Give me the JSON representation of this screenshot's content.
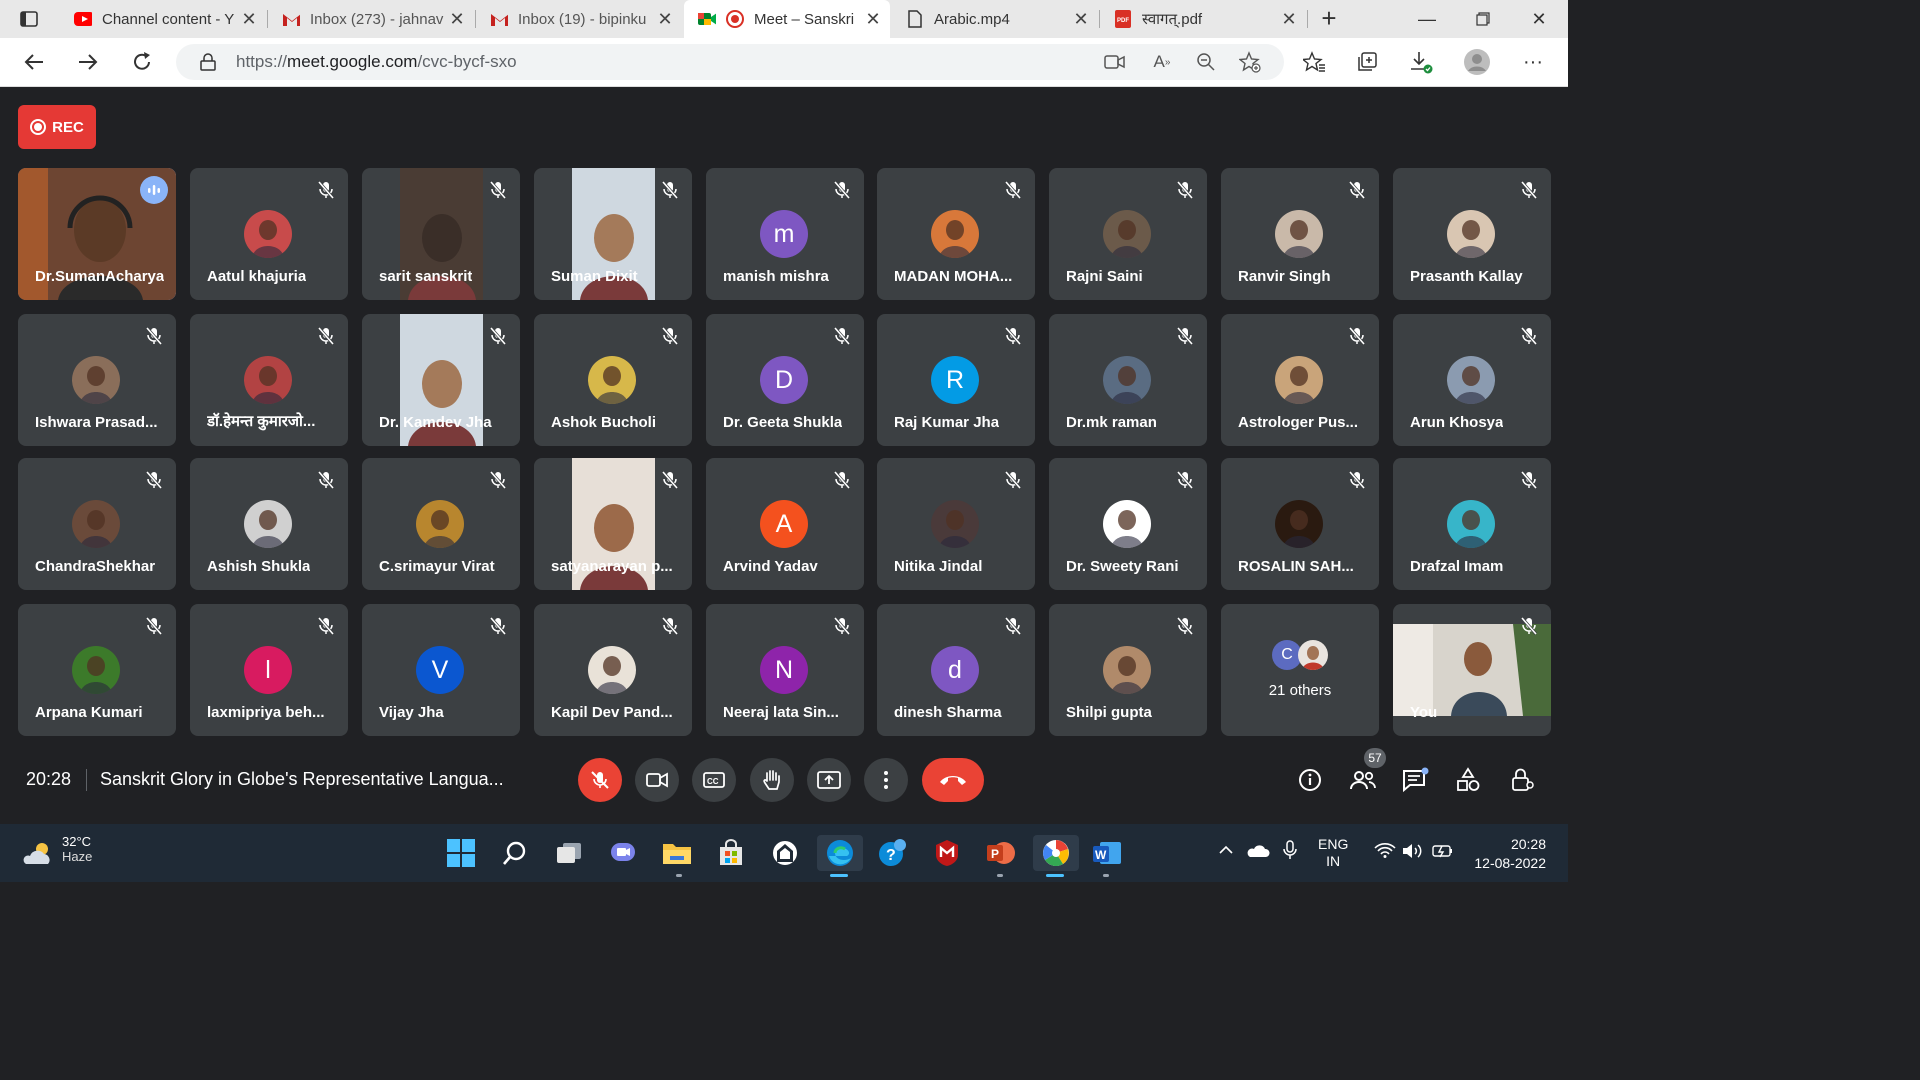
{
  "browser": {
    "tabs": [
      {
        "title": "Channel content - Y",
        "icon": "youtube-icon"
      },
      {
        "title": "Inbox (273) - jahnav",
        "icon": "gmail-icon"
      },
      {
        "title": "Inbox (19) - bipinku",
        "icon": "gmail-icon"
      },
      {
        "title": "Meet – Sanskri",
        "icon": "meet-icon",
        "active": true
      },
      {
        "title": "Arabic.mp4",
        "icon": "file-icon"
      },
      {
        "title": "स्वागत्.pdf",
        "icon": "pdf-icon"
      }
    ],
    "url_prefix": "https://",
    "url_host": "meet.google.com",
    "url_path": "/cvc-bycf-sxo"
  },
  "meet": {
    "rec_label": "REC",
    "participants": [
      {
        "name": "Dr.SumanAcharya",
        "tile": "video",
        "speaking": true
      },
      {
        "name": "Aatul khajuria",
        "tile": "photo",
        "color": "#c84b4b"
      },
      {
        "name": "sarit sanskrit",
        "tile": "video"
      },
      {
        "name": "Suman Dixit",
        "tile": "video"
      },
      {
        "name": "manish mishra",
        "tile": "letter",
        "letter": "m",
        "color": "#7e57c2"
      },
      {
        "name": "MADAN MOHA...",
        "tile": "photo",
        "color": "#d8783a"
      },
      {
        "name": "Rajni Saini",
        "tile": "photo",
        "color": "#6b5a4a"
      },
      {
        "name": "Ranvir Singh",
        "tile": "photo",
        "color": "#c9b9a9"
      },
      {
        "name": "Prasanth Kallay",
        "tile": "photo",
        "color": "#d9c6b2"
      },
      {
        "name": "Ishwara Prasad...",
        "tile": "photo",
        "color": "#8a6e5a"
      },
      {
        "name": "डॉ.हेमन्त कुमारजो...",
        "tile": "photo",
        "color": "#b24343"
      },
      {
        "name": "Dr. Kamdev Jha",
        "tile": "video"
      },
      {
        "name": "Ashok Bucholi",
        "tile": "photo",
        "color": "#d7b84a"
      },
      {
        "name": "Dr. Geeta Shukla",
        "tile": "letter",
        "letter": "D",
        "color": "#7e57c2"
      },
      {
        "name": "Raj Kumar Jha",
        "tile": "letter",
        "letter": "R",
        "color": "#039be5"
      },
      {
        "name": "Dr.mk raman",
        "tile": "photo",
        "color": "#5a6c82"
      },
      {
        "name": "Astrologer Pus...",
        "tile": "photo",
        "color": "#c9a47a"
      },
      {
        "name": "Arun Khosya",
        "tile": "photo",
        "color": "#8b9bb0"
      },
      {
        "name": "ChandraShekhar",
        "tile": "photo",
        "color": "#6a4a3a"
      },
      {
        "name": "Ashish Shukla",
        "tile": "photo",
        "color": "#d0d0d0"
      },
      {
        "name": "C.srimayur Virat",
        "tile": "photo",
        "color": "#b8862e"
      },
      {
        "name": "satyanarayan p...",
        "tile": "video"
      },
      {
        "name": "Arvind Yadav",
        "tile": "letter",
        "letter": "A",
        "color": "#f4511e"
      },
      {
        "name": "Nitika Jindal",
        "tile": "photo",
        "color": "#4a3a3a"
      },
      {
        "name": "Dr. Sweety Rani",
        "tile": "photo",
        "color": "#ffffff"
      },
      {
        "name": "ROSALIN SAH...",
        "tile": "photo",
        "color": "#2a1a10"
      },
      {
        "name": "Drafzal Imam",
        "tile": "photo",
        "color": "#37b5c9"
      },
      {
        "name": "Arpana Kumari",
        "tile": "photo",
        "color": "#3c7a2a"
      },
      {
        "name": "laxmipriya beh...",
        "tile": "letter",
        "letter": "l",
        "color": "#d81b60"
      },
      {
        "name": "Vijay Jha",
        "tile": "letter",
        "letter": "V",
        "color": "#0b57d0"
      },
      {
        "name": "Kapil Dev Pand...",
        "tile": "photo",
        "color": "#e9e2d8"
      },
      {
        "name": "Neeraj lata Sin...",
        "tile": "letter",
        "letter": "N",
        "color": "#8e24aa"
      },
      {
        "name": "dinesh Sharma",
        "tile": "letter",
        "letter": "d",
        "color": "#7e57c2"
      },
      {
        "name": "Shilpi gupta",
        "tile": "photo",
        "color": "#b08a6a"
      },
      {
        "name": "21 others",
        "tile": "others",
        "letter": "C",
        "color": "#5c6bc0"
      },
      {
        "name": "You",
        "tile": "video-self"
      }
    ],
    "clock": "20:28",
    "meeting_title": "Sanskrit Glory in Globe's Representative Langua...",
    "people_count": "57"
  },
  "taskbar": {
    "temperature": "32°C",
    "weather": "Haze",
    "lang_top": "ENG",
    "lang_bottom": "IN",
    "time": "20:28",
    "date": "12-08-2022"
  }
}
